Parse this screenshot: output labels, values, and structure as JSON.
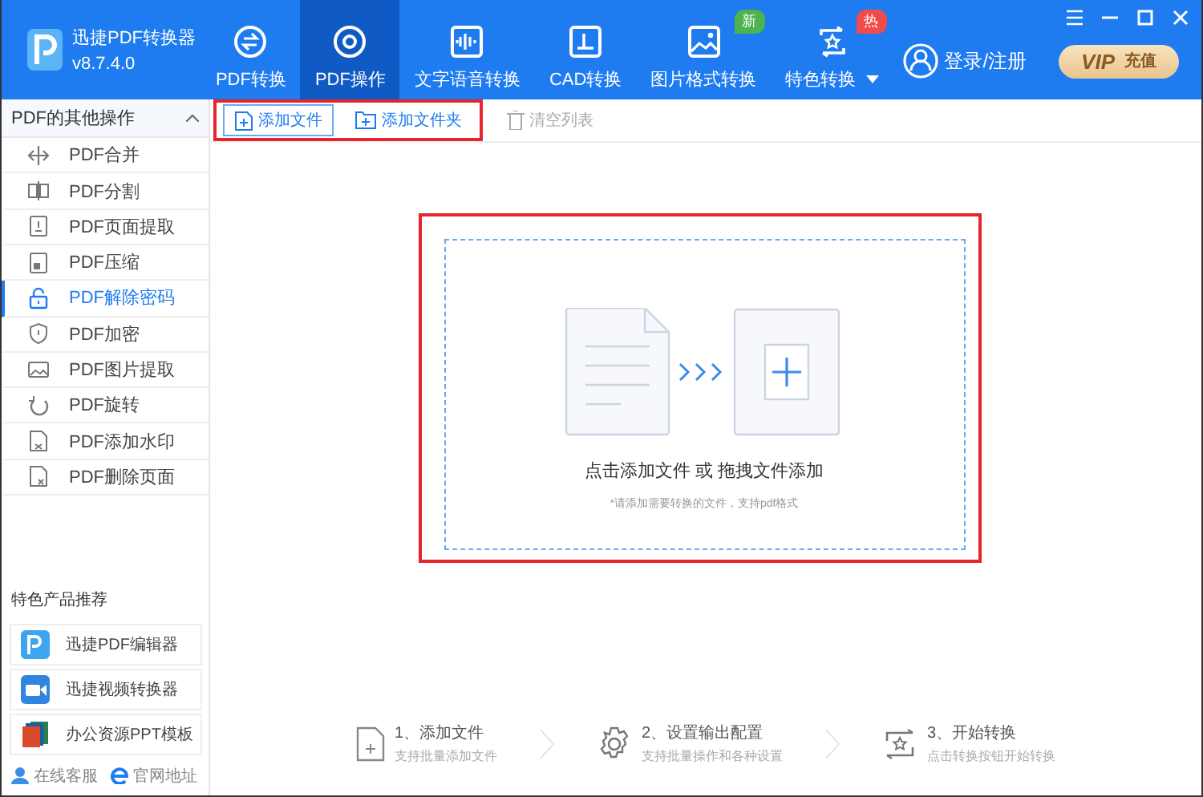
{
  "app": {
    "name": "迅捷PDF转换器",
    "version": "v8.7.4.0"
  },
  "nav": [
    {
      "label": "PDF转换",
      "selected": false
    },
    {
      "label": "PDF操作",
      "selected": true
    },
    {
      "label": "文字语音转换",
      "selected": false
    },
    {
      "label": "CAD转换",
      "selected": false
    },
    {
      "label": "图片格式转换",
      "selected": false,
      "badge": {
        "text": "新",
        "color": "#4cb34f"
      }
    },
    {
      "label": "特色转换",
      "selected": false,
      "badge": {
        "text": "热",
        "color": "#f04b4b"
      },
      "dropdown": true
    }
  ],
  "account": {
    "login": "登录/注册",
    "vip": "VIP",
    "vip_action": "充值"
  },
  "toolbar": [
    {
      "label": "添加文件",
      "selected": true,
      "disabled": false
    },
    {
      "label": "添加文件夹",
      "selected": false,
      "disabled": false
    },
    {
      "label": "清空列表",
      "selected": false,
      "disabled": true
    }
  ],
  "sidebar": {
    "title": "PDF的其他操作",
    "expanded": true,
    "items": [
      {
        "label": "PDF合并",
        "selected": false
      },
      {
        "label": "PDF分割",
        "selected": false
      },
      {
        "label": "PDF页面提取",
        "selected": false
      },
      {
        "label": "PDF压缩",
        "selected": false
      },
      {
        "label": "PDF解除密码",
        "selected": true
      },
      {
        "label": "PDF加密",
        "selected": false
      },
      {
        "label": "PDF图片提取",
        "selected": false
      },
      {
        "label": "PDF旋转",
        "selected": false
      },
      {
        "label": "PDF添加水印",
        "selected": false
      },
      {
        "label": "PDF删除页面",
        "selected": false
      }
    ]
  },
  "recommend": {
    "title": "特色产品推荐",
    "items": [
      "迅捷PDF编辑器",
      "迅捷视频转换器",
      "办公资源PPT模板"
    ]
  },
  "links": [
    "在线客服",
    "官网地址"
  ],
  "drop_zone": {
    "prompt": "点击添加文件 或 拖拽文件添加",
    "hint": "*请添加需要转换的文件，支持pdf格式"
  },
  "steps": [
    {
      "title": "1、添加文件",
      "description": "支持批量添加文件"
    },
    {
      "title": "2、设置输出配置",
      "description": "支持批量操作和各种设置"
    },
    {
      "title": "3、开始转换",
      "description": "点击转换按钮开始转换"
    }
  ]
}
